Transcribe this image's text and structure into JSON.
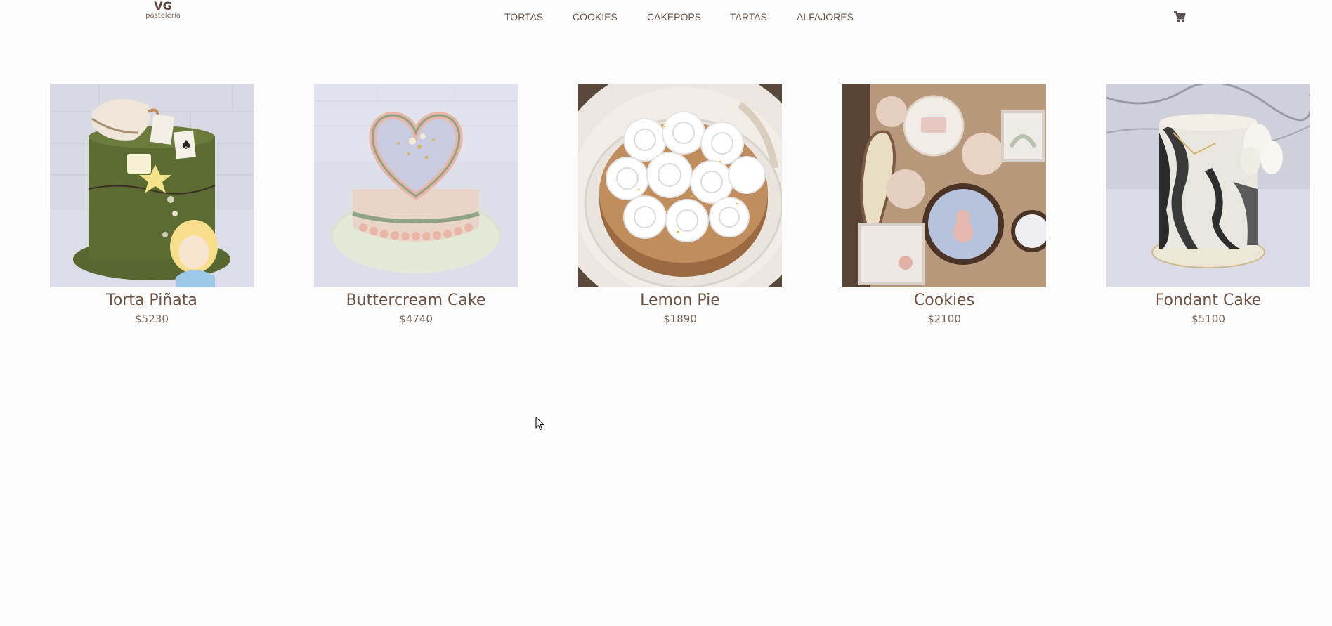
{
  "header": {
    "logo_mark": "VG",
    "logo_sub": "pastelería",
    "nav": [
      {
        "label": "TORTAS"
      },
      {
        "label": "COOKIES"
      },
      {
        "label": "CAKEPOPS"
      },
      {
        "label": "TARTAS"
      },
      {
        "label": "ALFAJORES"
      }
    ],
    "cart_icon": "shopping-cart-icon"
  },
  "products": [
    {
      "name": "Torta Piñata",
      "price": "$5230"
    },
    {
      "name": "Buttercream Cake",
      "price": "$4740"
    },
    {
      "name": "Lemon Pie",
      "price": "$1890"
    },
    {
      "name": "Cookies",
      "price": "$2100"
    },
    {
      "name": "Fondant Cake",
      "price": "$5100"
    }
  ],
  "colors": {
    "text": "#6b5242",
    "background": "#fdfdfd"
  }
}
